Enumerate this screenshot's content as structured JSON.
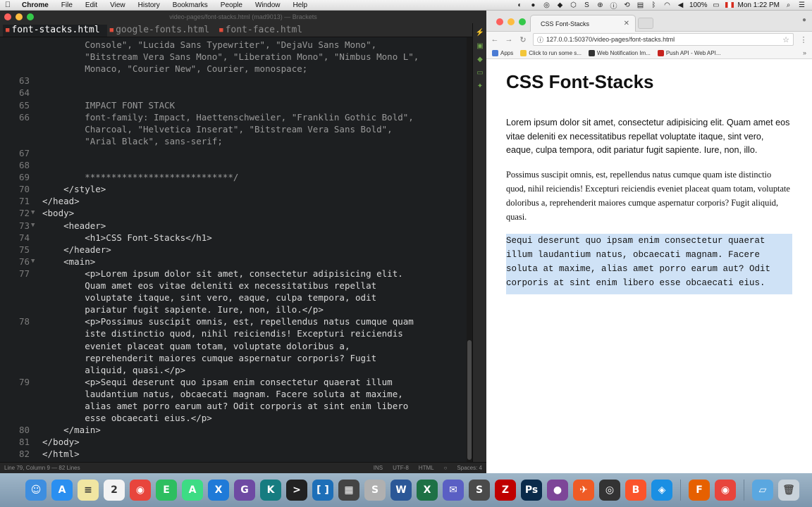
{
  "menubar": {
    "app_name": "Chrome",
    "items": [
      "File",
      "Edit",
      "View",
      "History",
      "Bookmarks",
      "People",
      "Window",
      "Help"
    ],
    "battery": "100%",
    "clock": "Mon 1:22 PM"
  },
  "editor": {
    "window_title": "video-pages/font-stacks.html (mad9013) — Brackets",
    "tabs": [
      {
        "label": "font-stacks.html",
        "active": true
      },
      {
        "label": "google-fonts.html",
        "active": false
      },
      {
        "label": "font-face.html",
        "active": false
      }
    ],
    "lines": [
      {
        "num": "",
        "text": "        Console\", \"Lucida Sans Typewriter\", \"DejaVu Sans Mono\","
      },
      {
        "num": "",
        "text": "        \"Bitstream Vera Sans Mono\", \"Liberation Mono\", \"Nimbus Mono L\","
      },
      {
        "num": "",
        "text": "        Monaco, \"Courier New\", Courier, monospace;"
      },
      {
        "num": "63",
        "text": ""
      },
      {
        "num": "64",
        "text": ""
      },
      {
        "num": "65",
        "text": "        IMPACT FONT STACK"
      },
      {
        "num": "66",
        "text": "        font-family: Impact, Haettenschweiler, \"Franklin Gothic Bold\","
      },
      {
        "num": "",
        "text": "        Charcoal, \"Helvetica Inserat\", \"Bitstream Vera Sans Bold\","
      },
      {
        "num": "",
        "text": "        \"Arial Black\", sans-serif;"
      },
      {
        "num": "67",
        "text": ""
      },
      {
        "num": "68",
        "text": ""
      },
      {
        "num": "69",
        "text": "        ****************************/"
      },
      {
        "num": "70",
        "text": "    </style>"
      },
      {
        "num": "71",
        "text": "</head>"
      },
      {
        "num": "72",
        "text": "<body>",
        "fold": true
      },
      {
        "num": "73",
        "text": "    <header>",
        "fold": true
      },
      {
        "num": "74",
        "text": "        <h1>CSS Font-Stacks</h1>"
      },
      {
        "num": "75",
        "text": "    </header>"
      },
      {
        "num": "76",
        "text": "    <main>",
        "fold": true
      },
      {
        "num": "77",
        "text": "        <p>Lorem ipsum dolor sit amet, consectetur adipisicing elit."
      },
      {
        "num": "",
        "text": "        Quam amet eos vitae deleniti ex necessitatibus repellat"
      },
      {
        "num": "",
        "text": "        voluptate itaque, sint vero, eaque, culpa tempora, odit"
      },
      {
        "num": "",
        "text": "        pariatur fugit sapiente. Iure, non, illo.</p>"
      },
      {
        "num": "78",
        "text": "        <p>Possimus suscipit omnis, est, repellendus natus cumque quam"
      },
      {
        "num": "",
        "text": "        iste distinctio quod, nihil reiciendis! Excepturi reiciendis"
      },
      {
        "num": "",
        "text": "        eveniet placeat quam totam, voluptate doloribus a,"
      },
      {
        "num": "",
        "text": "        reprehenderit maiores cumque aspernatur corporis? Fugit"
      },
      {
        "num": "",
        "text": "        aliquid, quasi.</p>"
      },
      {
        "num": "79",
        "text": "        <p>Sequi deserunt quo ipsam enim consectetur quaerat illum"
      },
      {
        "num": "",
        "text": "        laudantium natus, obcaecati magnam. Facere soluta at maxime,"
      },
      {
        "num": "",
        "text": "        alias amet porro earum aut? Odit corporis at sint enim libero"
      },
      {
        "num": "",
        "text": "        esse obcaecati eius.</p>"
      },
      {
        "num": "80",
        "text": "    </main>"
      },
      {
        "num": "81",
        "text": "</body>"
      },
      {
        "num": "82",
        "text": "</html>"
      }
    ],
    "status": {
      "cursor": "Line 79, Column 9 — 82 Lines",
      "mode": "INS",
      "encoding": "UTF-8",
      "language": "HTML",
      "spaces": "Spaces: 4"
    }
  },
  "browser": {
    "tab_title": "CSS Font-Stacks",
    "url": "127.0.0.1:50370/video-pages/font-stacks.html",
    "bookmarks": [
      "Apps",
      "Click to run some s...",
      "Web Notification Im...",
      "Push API - Web API..."
    ],
    "page": {
      "heading": "CSS Font-Stacks",
      "p1": "Lorem ipsum dolor sit amet, consectetur adipisicing elit. Quam amet eos vitae deleniti ex necessitatibus repellat voluptate itaque, sint vero, eaque, culpa tempora, odit pariatur fugit sapiente. Iure, non, illo.",
      "p2": "Possimus suscipit omnis, est, repellendus natus cumque quam iste distinctio quod, nihil reiciendis! Excepturi reiciendis eveniet placeat quam totam, voluptate doloribus a, reprehenderit maiores cumque aspernatur corporis? Fugit aliquid, quasi.",
      "p3": "Sequi deserunt quo ipsam enim consectetur quaerat illum laudantium natus, obcaecati magnam. Facere soluta at maxime, alias amet porro earum aut? Odit corporis at sint enim libero esse obcaecati eius."
    }
  },
  "dock": {
    "icons": [
      {
        "name": "finder-icon",
        "color": "#3d8ee0",
        "glyph": "☺"
      },
      {
        "name": "app-store-icon",
        "color": "#2a8ff0",
        "glyph": "A"
      },
      {
        "name": "notes-icon",
        "color": "#f1e6a2",
        "glyph": "≡"
      },
      {
        "name": "calendar-icon",
        "color": "#f3f3f3",
        "glyph": "2"
      },
      {
        "name": "chrome-icon",
        "color": "#e8453c",
        "glyph": "◉"
      },
      {
        "name": "evernote-icon",
        "color": "#2dbe60",
        "glyph": "E"
      },
      {
        "name": "android-studio-icon",
        "color": "#3ddc84",
        "glyph": "A"
      },
      {
        "name": "xcode-icon",
        "color": "#1f7ad8",
        "glyph": "X"
      },
      {
        "name": "github-icon",
        "color": "#6e4aa3",
        "glyph": "G"
      },
      {
        "name": "gitkraken-icon",
        "color": "#167c80",
        "glyph": "K"
      },
      {
        "name": "terminal-icon",
        "color": "#222222",
        "glyph": ">"
      },
      {
        "name": "brackets-icon",
        "color": "#1d6fb8",
        "glyph": "[ ]"
      },
      {
        "name": "app-icon",
        "color": "#444444",
        "glyph": "▦"
      },
      {
        "name": "sequel-icon",
        "color": "#b0b0b0",
        "glyph": "S"
      },
      {
        "name": "word-icon",
        "color": "#2b5797",
        "glyph": "W"
      },
      {
        "name": "excel-icon",
        "color": "#1e7145",
        "glyph": "X"
      },
      {
        "name": "teams-icon",
        "color": "#5a5fc4",
        "glyph": "✉"
      },
      {
        "name": "sublime-icon",
        "color": "#4a4a4a",
        "glyph": "S"
      },
      {
        "name": "filezilla-icon",
        "color": "#bf0000",
        "glyph": "Z"
      },
      {
        "name": "photoshop-icon",
        "color": "#0a2a4a",
        "glyph": "Ps"
      },
      {
        "name": "tor-icon",
        "color": "#7d4698",
        "glyph": "●"
      },
      {
        "name": "postman-icon",
        "color": "#ef5b25",
        "glyph": "✈"
      },
      {
        "name": "aperture-icon",
        "color": "#333333",
        "glyph": "◎"
      },
      {
        "name": "brave-icon",
        "color": "#fb542b",
        "glyph": "B"
      },
      {
        "name": "safari-icon",
        "color": "#1a8fe3",
        "glyph": "◈"
      },
      {
        "name": "firefox-icon",
        "color": "#e66000",
        "glyph": "F"
      },
      {
        "name": "chrome-canary-icon",
        "color": "#e8453c",
        "glyph": "◉"
      }
    ]
  }
}
